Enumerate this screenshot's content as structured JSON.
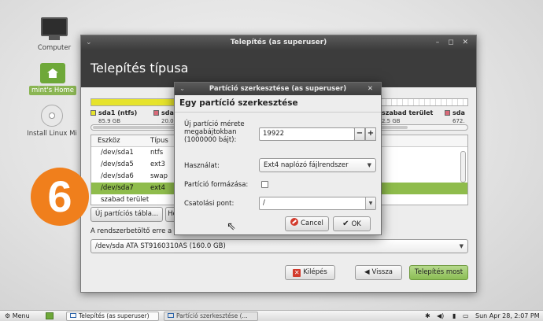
{
  "desktop": {
    "icons": [
      {
        "label": "Computer"
      },
      {
        "label": "mint's Home"
      },
      {
        "label": "Install Linux Mi"
      }
    ],
    "step_number": "6"
  },
  "main_window": {
    "title": "Telepítés (as superuser)",
    "heading": "Telepítés típusa",
    "partitions": [
      {
        "name": "sda1 (ntfs)",
        "size": "85.9 GB",
        "color": "#e6e32c"
      },
      {
        "name": "sda",
        "size": "20.0",
        "color": "#d86a79"
      },
      {
        "name": "szabad terület",
        "size": "2.5 GB",
        "color": "#ffffff"
      },
      {
        "name": "sda",
        "size": "672.",
        "color": "#d86a79"
      }
    ],
    "table": {
      "columns": [
        "Eszköz",
        "Típus"
      ],
      "rows": [
        {
          "device": "/dev/sda1",
          "type": "ntfs"
        },
        {
          "device": "/dev/sda5",
          "type": "ext3"
        },
        {
          "device": "/dev/sda6",
          "type": "swap"
        },
        {
          "device": "/dev/sda7",
          "type": "ext4",
          "selected": true
        },
        {
          "device": "szabad terület",
          "type": ""
        }
      ]
    },
    "new_table_button": "Új partíciós tábla...",
    "partial_button": "Ho",
    "bootloader_label": "A rendszerbetöltő erre a",
    "bootloader_device": "/dev/sda   ATA ST9160310AS (160.0 GB)",
    "buttons": {
      "quit": "Kilépés",
      "back": "Vissza",
      "install": "Telepítés most"
    }
  },
  "dialog": {
    "title": "Partíció szerkesztése (as superuser)",
    "heading": "Egy partíció szerkesztése",
    "size_label": "Új partíció mérete megabájtokban (1000000 bájt):",
    "size_value": "19922",
    "use_label": "Használat:",
    "use_value": "Ext4 naplózó fájlrendszer",
    "format_label": "Partíció formázása:",
    "format_checked": false,
    "mount_label": "Csatolási pont:",
    "mount_value": "/",
    "cancel": "Cancel",
    "ok": "OK"
  },
  "taskbar": {
    "menu": "Menu",
    "tasks": [
      "Telepítés (as superuser)",
      "Partíció szerkesztése (..."
    ],
    "clock": "Sun Apr 28,  2:07 PM"
  }
}
